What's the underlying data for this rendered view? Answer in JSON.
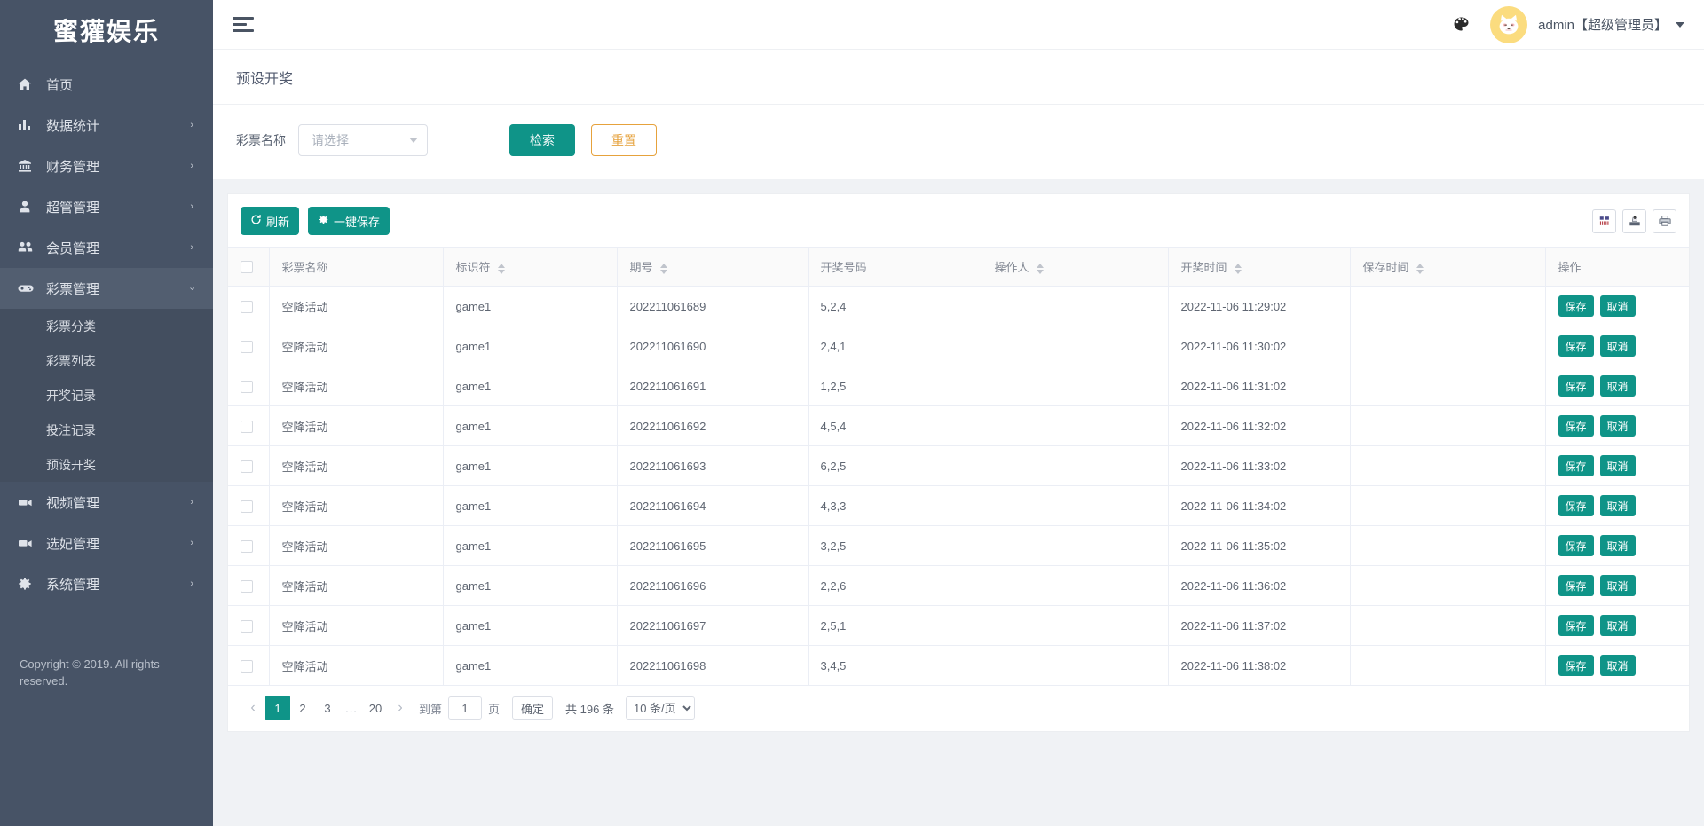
{
  "brand": {
    "title": "蜜獾娱乐"
  },
  "sidebar": {
    "items": [
      {
        "label": "首页",
        "icon": "home-icon",
        "arrow": ""
      },
      {
        "label": "数据统计",
        "icon": "bar-chart-icon",
        "arrow": "›"
      },
      {
        "label": "财务管理",
        "icon": "bank-icon",
        "arrow": "›"
      },
      {
        "label": "超管管理",
        "icon": "user-icon",
        "arrow": "›"
      },
      {
        "label": "会员管理",
        "icon": "users-icon",
        "arrow": "›"
      },
      {
        "label": "彩票管理",
        "icon": "gamepad-icon",
        "arrow": "›",
        "active": true
      },
      {
        "label": "视频管理",
        "icon": "video-icon",
        "arrow": "›"
      },
      {
        "label": "选妃管理",
        "icon": "video-icon",
        "arrow": "›"
      },
      {
        "label": "系统管理",
        "icon": "gear-icon",
        "arrow": "›"
      }
    ],
    "submenu": [
      {
        "label": "彩票分类"
      },
      {
        "label": "彩票列表"
      },
      {
        "label": "开奖记录"
      },
      {
        "label": "投注记录"
      },
      {
        "label": "预设开奖"
      }
    ],
    "copyright": "Copyright © 2019. All rights reserved."
  },
  "topbar": {
    "menu_icon": "hamburger-icon",
    "palette_icon": "palette-icon",
    "username": "admin【超级管理员】",
    "avatar_icon": "cat-avatar-icon"
  },
  "page": {
    "title": "预设开奖"
  },
  "search": {
    "label": "彩票名称",
    "placeholder": "请选择",
    "submit_label": "检索",
    "reset_label": "重置"
  },
  "toolbar": {
    "refresh_label": "刷新",
    "refresh_icon": "refresh-icon",
    "save_all_label": "一键保存",
    "save_all_icon": "gear-icon",
    "columns_icon": "columns-icon",
    "export_icon": "export-icon",
    "print_icon": "print-icon"
  },
  "table": {
    "columns": [
      {
        "key": "checkbox",
        "label": "",
        "sortable": false
      },
      {
        "key": "name",
        "label": "彩票名称",
        "sortable": false
      },
      {
        "key": "code",
        "label": "标识符",
        "sortable": true
      },
      {
        "key": "issue",
        "label": "期号",
        "sortable": true
      },
      {
        "key": "numbers",
        "label": "开奖号码",
        "sortable": false
      },
      {
        "key": "operator",
        "label": "操作人",
        "sortable": true
      },
      {
        "key": "draw_time",
        "label": "开奖时间",
        "sortable": true
      },
      {
        "key": "save_time",
        "label": "保存时间",
        "sortable": true
      },
      {
        "key": "actions",
        "label": "操作",
        "sortable": false
      }
    ],
    "action_labels": {
      "save": "保存",
      "cancel": "取消"
    },
    "rows": [
      {
        "name": "空降活动",
        "code": "game1",
        "issue": "202211061689",
        "numbers": "5,2,4",
        "operator": "",
        "draw_time": "2022-11-06 11:29:02",
        "save_time": ""
      },
      {
        "name": "空降活动",
        "code": "game1",
        "issue": "202211061690",
        "numbers": "2,4,1",
        "operator": "",
        "draw_time": "2022-11-06 11:30:02",
        "save_time": ""
      },
      {
        "name": "空降活动",
        "code": "game1",
        "issue": "202211061691",
        "numbers": "1,2,5",
        "operator": "",
        "draw_time": "2022-11-06 11:31:02",
        "save_time": ""
      },
      {
        "name": "空降活动",
        "code": "game1",
        "issue": "202211061692",
        "numbers": "4,5,4",
        "operator": "",
        "draw_time": "2022-11-06 11:32:02",
        "save_time": ""
      },
      {
        "name": "空降活动",
        "code": "game1",
        "issue": "202211061693",
        "numbers": "6,2,5",
        "operator": "",
        "draw_time": "2022-11-06 11:33:02",
        "save_time": ""
      },
      {
        "name": "空降活动",
        "code": "game1",
        "issue": "202211061694",
        "numbers": "4,3,3",
        "operator": "",
        "draw_time": "2022-11-06 11:34:02",
        "save_time": ""
      },
      {
        "name": "空降活动",
        "code": "game1",
        "issue": "202211061695",
        "numbers": "3,2,5",
        "operator": "",
        "draw_time": "2022-11-06 11:35:02",
        "save_time": ""
      },
      {
        "name": "空降活动",
        "code": "game1",
        "issue": "202211061696",
        "numbers": "2,2,6",
        "operator": "",
        "draw_time": "2022-11-06 11:36:02",
        "save_time": ""
      },
      {
        "name": "空降活动",
        "code": "game1",
        "issue": "202211061697",
        "numbers": "2,5,1",
        "operator": "",
        "draw_time": "2022-11-06 11:37:02",
        "save_time": ""
      },
      {
        "name": "空降活动",
        "code": "game1",
        "issue": "202211061698",
        "numbers": "3,4,5",
        "operator": "",
        "draw_time": "2022-11-06 11:38:02",
        "save_time": ""
      }
    ]
  },
  "pagination": {
    "prev_icon": "chevron-left-icon",
    "next_icon": "chevron-right-icon",
    "pages": [
      "1",
      "2",
      "3"
    ],
    "ellipsis": "...",
    "last_page": "20",
    "current": "1",
    "goto_prefix": "到第",
    "goto_value": "1",
    "goto_suffix": "页",
    "confirm_label": "确定",
    "total_label": "共 196 条",
    "page_size": "10 条/页"
  },
  "colors": {
    "sidebar_bg": "#475366",
    "accent": "#0f9488",
    "warn": "#e6a23c",
    "number_red": "#f23c3c",
    "avatar_bg": "#fbdc7f"
  }
}
